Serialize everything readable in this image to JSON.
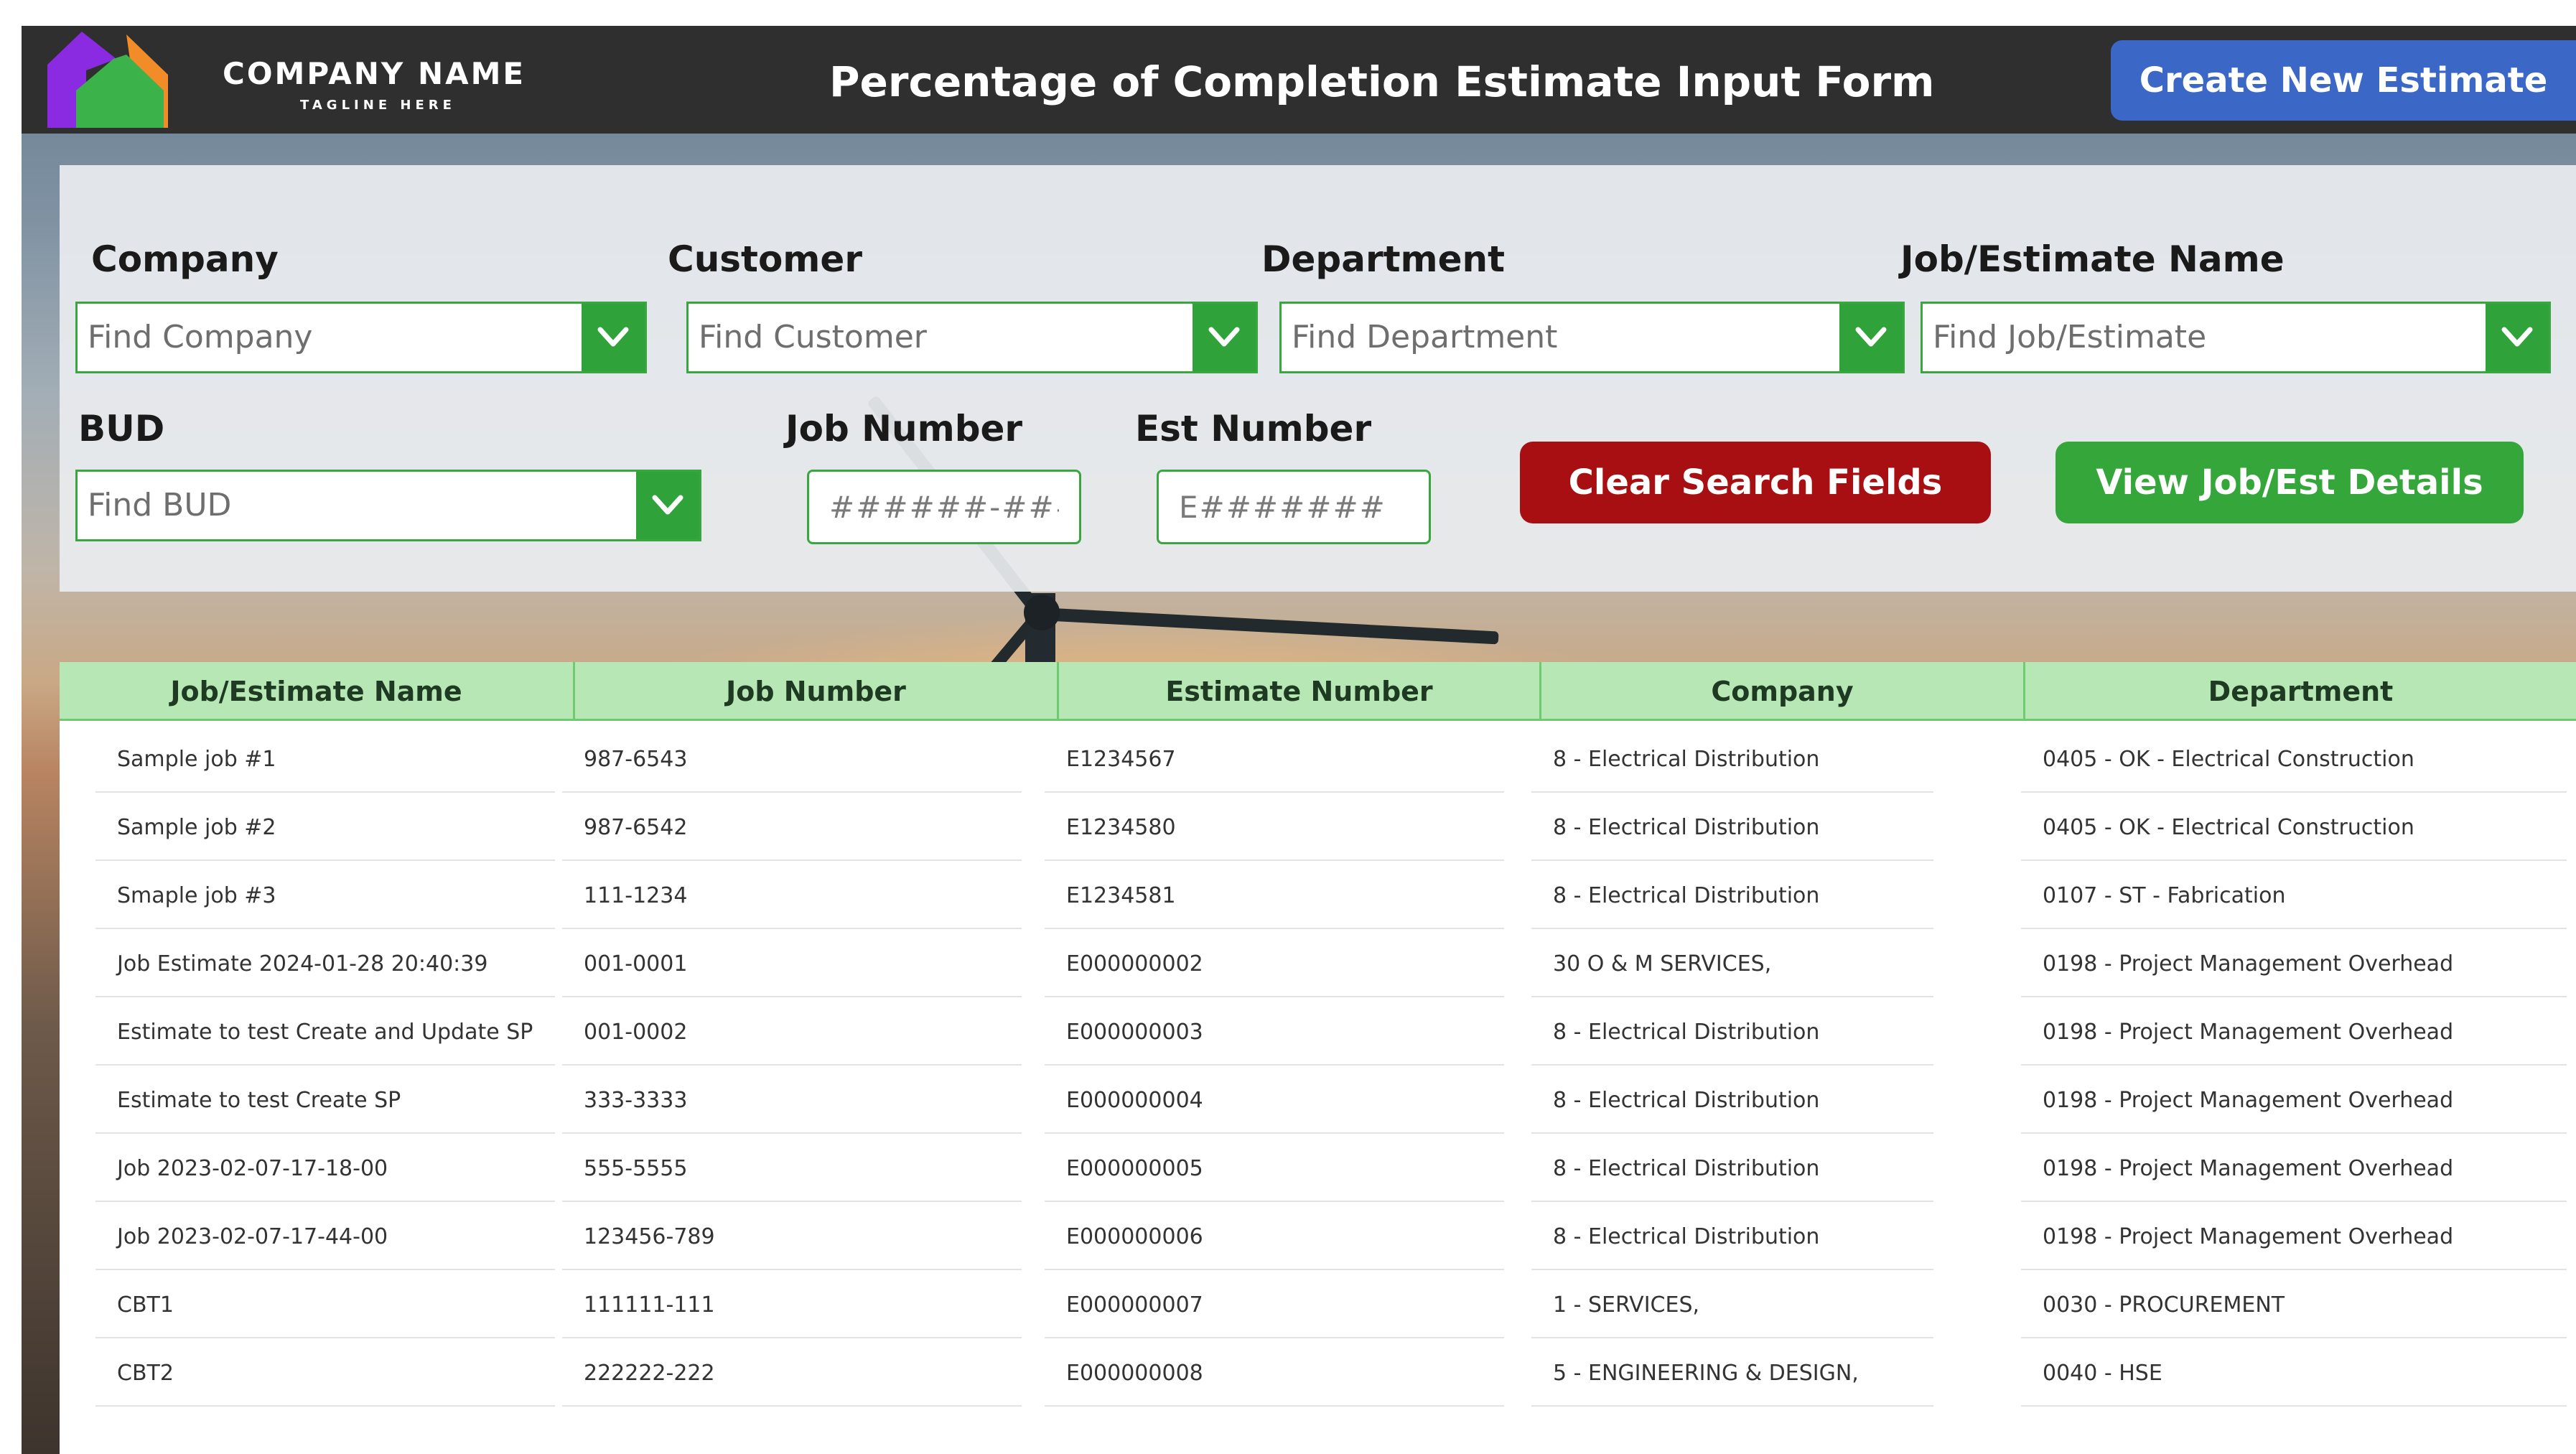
{
  "header": {
    "company_name": "COMPANY NAME",
    "tagline": "TAGLINE HERE",
    "title": "Percentage of Completion Estimate Input Form",
    "create_button": "Create New Estimate"
  },
  "search": {
    "company": {
      "label": "Company",
      "placeholder": "Find Company"
    },
    "customer": {
      "label": "Customer",
      "placeholder": "Find Customer"
    },
    "department": {
      "label": "Department",
      "placeholder": "Find Department"
    },
    "job_name": {
      "label": "Job/Estimate Name",
      "placeholder": "Find Job/Estimate"
    },
    "bud": {
      "label": "BUD",
      "placeholder": "Find BUD"
    },
    "job_number": {
      "label": "Job Number",
      "placeholder": "######-###"
    },
    "est_number": {
      "label": "Est Number",
      "placeholder": "E#######"
    },
    "clear_button": "Clear Search Fields",
    "view_button": "View Job/Est Details"
  },
  "table": {
    "columns": [
      "Job/Estimate Name",
      "Job Number",
      "Estimate Number",
      "Company",
      "Department"
    ],
    "rows": [
      [
        "Sample job #1",
        "987-6543",
        "E1234567",
        "8 - Electrical Distribution",
        "0405 - OK - Electrical Construction"
      ],
      [
        "Sample job #2",
        "987-6542",
        "E1234580",
        "8 - Electrical Distribution",
        "0405 - OK - Electrical Construction"
      ],
      [
        "Smaple job #3",
        "111-1234",
        "E1234581",
        "8 - Electrical Distribution",
        "0107 - ST - Fabrication"
      ],
      [
        "Job Estimate 2024-01-28 20:40:39",
        "001-0001",
        "E000000002",
        "30 O & M SERVICES,",
        "0198 - Project Management Overhead"
      ],
      [
        "Estimate to test Create and Update SP",
        "001-0002",
        "E000000003",
        "8 - Electrical Distribution",
        "0198 - Project Management Overhead"
      ],
      [
        "Estimate to test Create SP",
        "333-3333",
        "E000000004",
        "8 - Electrical Distribution",
        "0198 - Project Management Overhead"
      ],
      [
        "Job 2023-02-07-17-18-00",
        "555-5555",
        "E000000005",
        "8 - Electrical Distribution",
        "0198 - Project Management Overhead"
      ],
      [
        "Job 2023-02-07-17-44-00",
        "123456-789",
        "E000000006",
        "8 - Electrical Distribution",
        "0198 - Project Management Overhead"
      ],
      [
        "CBT1",
        "111111-111",
        "E000000007",
        "1 - SERVICES,",
        "0030 - PROCUREMENT"
      ],
      [
        "CBT2",
        "222222-222",
        "E000000008",
        "5 - ENGINEERING & DESIGN,",
        "0040 - HSE"
      ]
    ]
  },
  "icons": {
    "dropdown": "chevron-down-icon",
    "logo": "house-logo-icon"
  },
  "colors": {
    "header_bg": "#2f2f2f",
    "create_button": "#3b67c6",
    "accent_green": "#35a63a",
    "clear_red": "#a80f12",
    "table_header": "#b7e7b4"
  }
}
